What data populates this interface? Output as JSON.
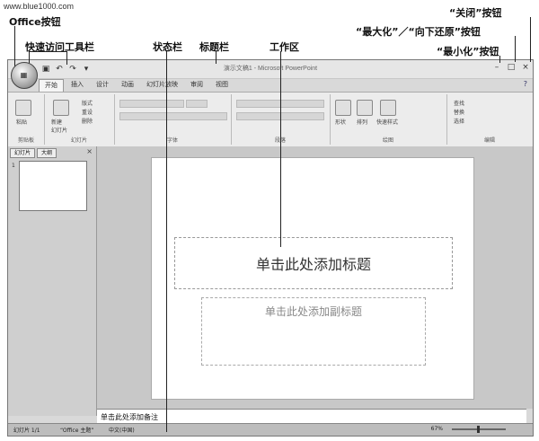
{
  "watermark": "www.blue1000.com",
  "callouts": {
    "office_button": "Office按钮",
    "quick_access": "快速访问工具栏",
    "status_bar": "状态栏",
    "title_bar": "标题栏",
    "work_area": "工作区",
    "close": "“关闭”按钮",
    "maximize_restore": "“最大化”／“向下还原”按钮",
    "minimize": "“最小化”按钮"
  },
  "window": {
    "title": "演示文稿1 - Microsoft PowerPoint",
    "tabs": [
      "开始",
      "插入",
      "设计",
      "动画",
      "幻灯片放映",
      "审阅",
      "视图"
    ],
    "groups": [
      "剪贴板",
      "幻灯片",
      "字体",
      "段落",
      "绘图",
      "编辑"
    ],
    "ribbon_labels": {
      "paste": "粘贴",
      "new_slide": "新建\n幻灯片",
      "layout": "版式",
      "reset": "重设",
      "delete": "删除",
      "shape": "形状",
      "arrange": "排列",
      "quick_styles": "快速样式",
      "find": "查找",
      "replace": "替换",
      "select": "选择"
    },
    "panel_tabs": [
      "幻灯片",
      "大纲"
    ],
    "panel_close": "×",
    "thumb_number": "1",
    "slide_title_placeholder": "单击此处添加标题",
    "slide_subtitle_placeholder": "单击此处添加副标题",
    "notes_placeholder": "单击此处添加备注",
    "status": {
      "slide": "幻灯片 1/1",
      "theme": "“Office 主题”",
      "language": "中文(中国)",
      "zoom": "67%"
    }
  }
}
